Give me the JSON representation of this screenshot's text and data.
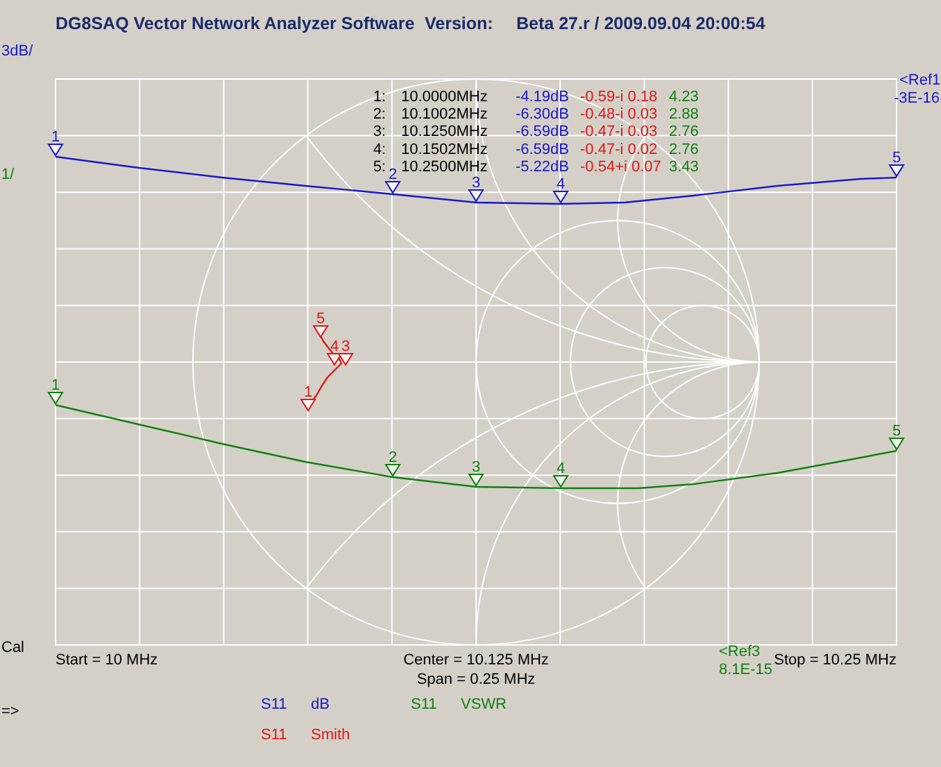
{
  "window": {
    "title": "DG8SAQ Vector Network Analyzer Software",
    "version_label": "Version:",
    "version": "Beta 27.r / 2009.09.04 20:00:54"
  },
  "scales": [
    {
      "label": "3dB/",
      "color": "#1818c8"
    },
    {
      "label": "1/",
      "color": "#108010"
    }
  ],
  "references": [
    {
      "label": "<Ref1",
      "value": "-3E-16",
      "color": "#1818c8"
    },
    {
      "label": "<Ref3",
      "value": "8.1E-15",
      "color": "#108010"
    }
  ],
  "markers": [
    {
      "number": "1:",
      "frequency": "10.0000MHz",
      "db": "-4.19dB",
      "smith": "-0.59-i 0.18",
      "vswr": "4.23"
    },
    {
      "number": "2:",
      "frequency": "10.1002MHz",
      "db": "-6.30dB",
      "smith": "-0.48-i 0.03",
      "vswr": "2.88"
    },
    {
      "number": "3:",
      "frequency": "10.1250MHz",
      "db": "-6.59dB",
      "smith": "-0.47-i 0.03",
      "vswr": "2.76"
    },
    {
      "number": "4:",
      "frequency": "10.1502MHz",
      "db": "-6.59dB",
      "smith": "-0.47-i 0.02",
      "vswr": "2.76"
    },
    {
      "number": "5:",
      "frequency": "10.2500MHz",
      "db": "-5.22dB",
      "smith": "-0.54+i 0.07",
      "vswr": "3.43"
    }
  ],
  "traces": [
    {
      "parameter": "S11",
      "format": "dB",
      "color": "#1818c8",
      "marker_labels": [
        "1",
        "2",
        "3",
        "4",
        "5"
      ]
    },
    {
      "parameter": "S11",
      "format": "VSWR",
      "color": "#108010",
      "marker_labels": [
        "1",
        "2",
        "3",
        "4",
        "5"
      ]
    },
    {
      "parameter": "S11",
      "format": "Smith",
      "color": "#e01818",
      "marker_labels": [
        "1",
        "4",
        "3",
        "5"
      ]
    }
  ],
  "sweep": {
    "status": "Cal",
    "start": "Start = 10 MHz",
    "center": "Center = 10.125 MHz",
    "span": "Span = 0.25 MHz",
    "stop": "Stop = 10.25 MHz"
  },
  "prompt": "=>"
}
